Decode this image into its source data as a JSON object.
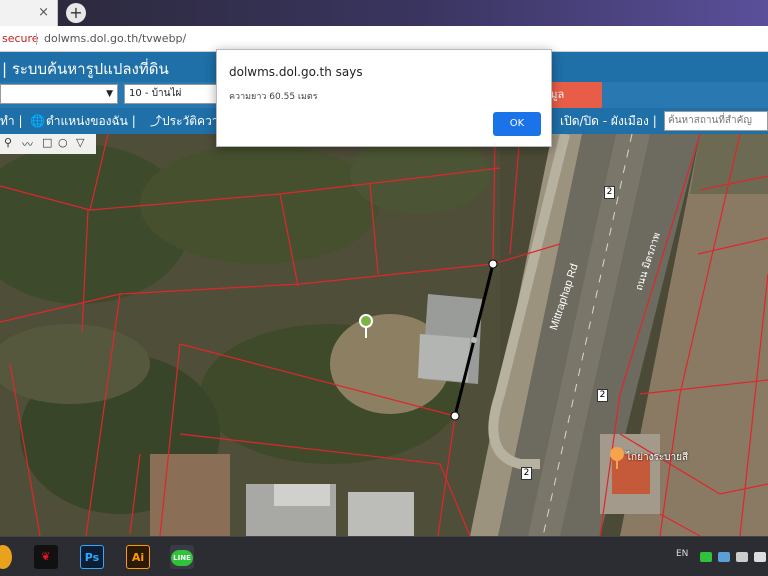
{
  "browser": {
    "tab_close": "×",
    "new_tab": "+",
    "security_label": "secure",
    "url": "dolwms.dol.go.th/tvwebp/"
  },
  "app": {
    "title": "| ระบบค้นหารูปแปลงที่ดิน",
    "province_select": "",
    "district_select": "10 - บ้านไผ่",
    "search_button": "าข้อมูล"
  },
  "toolbar": {
    "item1": "ทำ |",
    "item2": "ตำแหน่งของฉัน |",
    "item3": "ประวัติควา",
    "item4": "เปิด/ปิด - ผังเมือง |",
    "search_placeholder": "ค้นหาสถานที่สำคัญ"
  },
  "map": {
    "road_label": "Mittraphap Rd",
    "road_label_thai": "ถนน มิตรภาพ",
    "route_marker": "2",
    "poi_label": "ไก่ย่างระบายสี"
  },
  "dialog": {
    "title": "dolwms.dol.go.th says",
    "message": "ความยาว 60.55 เมตร",
    "ok": "OK"
  },
  "taskbar": {
    "ps_label": "Ps",
    "ai_label": "Ai",
    "line_label": "LINE",
    "lang": "EN"
  },
  "colors": {
    "header_blue": "#1f6fa8",
    "parcel_red": "#e0262c",
    "dialog_button": "#1a73e8",
    "search_button": "#e85d47"
  }
}
